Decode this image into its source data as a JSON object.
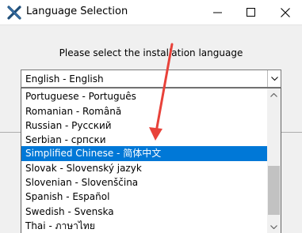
{
  "window": {
    "title": "Language Selection",
    "colors": {
      "accent": "#0078d7",
      "annotation_arrow": "#e8423a"
    }
  },
  "dialog": {
    "prompt": "Please select the installation language",
    "combo_value": "English - English"
  },
  "languages": {
    "items": [
      "Portuguese - Português",
      "Romanian - Română",
      "Russian - Русский",
      "Serbian - српски",
      "Simplified Chinese - 简体中文",
      "Slovak - Slovenský jazyk",
      "Slovenian - Slovenščina",
      "Spanish - Español",
      "Swedish - Svenska",
      "Thai - ภาษาไทย"
    ],
    "selected_index": 4
  },
  "icons": {
    "app": "x-logo-icon",
    "minimize": "minimize-icon",
    "maximize": "maximize-icon",
    "close": "close-icon",
    "dropdown": "chevron-down-icon",
    "scroll_up": "scroll-up-arrow-icon",
    "scroll_down": "scroll-down-arrow-icon"
  }
}
